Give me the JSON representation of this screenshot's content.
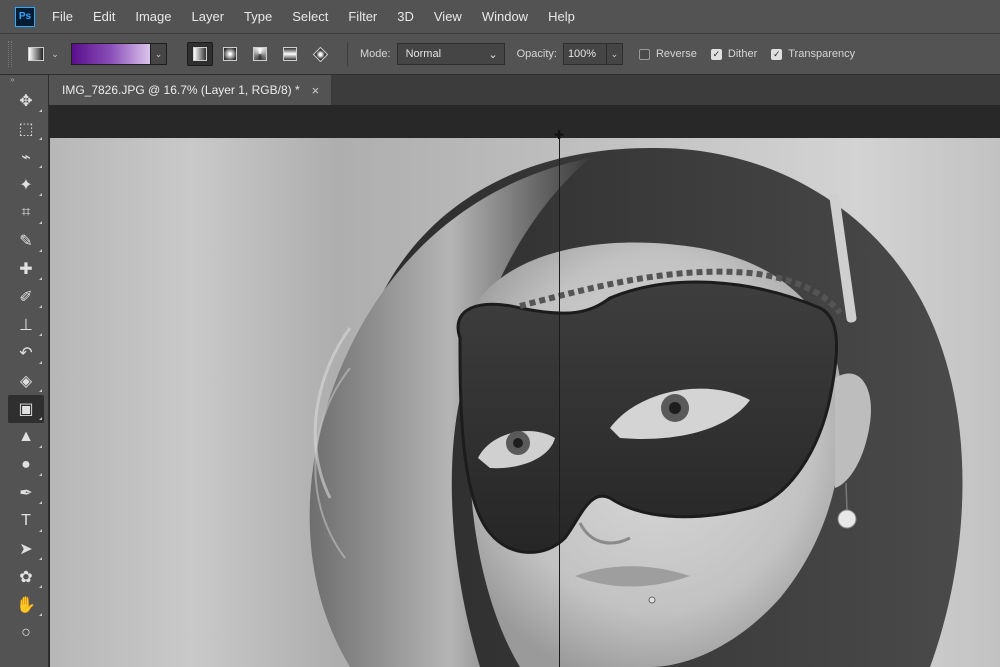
{
  "app": {
    "logo_text": "Ps",
    "menus": [
      "File",
      "Edit",
      "Image",
      "Layer",
      "Type",
      "Select",
      "Filter",
      "3D",
      "View",
      "Window",
      "Help"
    ]
  },
  "options": {
    "mode_label": "Mode:",
    "mode_value": "Normal",
    "opacity_label": "Opacity:",
    "opacity_value": "100%",
    "checks": [
      {
        "label": "Reverse",
        "checked": false
      },
      {
        "label": "Dither",
        "checked": true
      },
      {
        "label": "Transparency",
        "checked": true
      }
    ],
    "gradient_colors": {
      "start": "#5a0e8c",
      "end": "#dcc4ec"
    }
  },
  "document": {
    "tab_title": "IMG_7826.JPG @ 16.7% (Layer 1, RGB/8) *",
    "close_glyph": "×"
  },
  "toolbar": {
    "collapse_glyph": "»",
    "tools": [
      {
        "name": "move-tool-icon",
        "glyph": "✥"
      },
      {
        "name": "marquee-tool-icon",
        "glyph": "⬚"
      },
      {
        "name": "lasso-tool-icon",
        "glyph": "⌁"
      },
      {
        "name": "magic-wand-tool-icon",
        "glyph": "✦"
      },
      {
        "name": "crop-tool-icon",
        "glyph": "⌗"
      },
      {
        "name": "eyedropper-tool-icon",
        "glyph": "✎"
      },
      {
        "name": "healing-brush-tool-icon",
        "glyph": "✚"
      },
      {
        "name": "brush-tool-icon",
        "glyph": "✐"
      },
      {
        "name": "clone-stamp-tool-icon",
        "glyph": "⊥"
      },
      {
        "name": "history-brush-tool-icon",
        "glyph": "↶"
      },
      {
        "name": "eraser-tool-icon",
        "glyph": "◈"
      },
      {
        "name": "gradient-tool-icon",
        "glyph": "▣"
      },
      {
        "name": "blur-tool-icon",
        "glyph": "▲"
      },
      {
        "name": "dodge-tool-icon",
        "glyph": "●"
      },
      {
        "name": "pen-tool-icon",
        "glyph": "✒"
      },
      {
        "name": "type-tool-icon",
        "glyph": "T"
      },
      {
        "name": "path-selection-tool-icon",
        "glyph": "➤"
      },
      {
        "name": "shape-tool-icon",
        "glyph": "✿"
      },
      {
        "name": "hand-tool-icon",
        "glyph": "✋"
      },
      {
        "name": "zoom-tool-icon",
        "glyph": "○"
      }
    ],
    "active_tool": "gradient-tool-icon"
  }
}
